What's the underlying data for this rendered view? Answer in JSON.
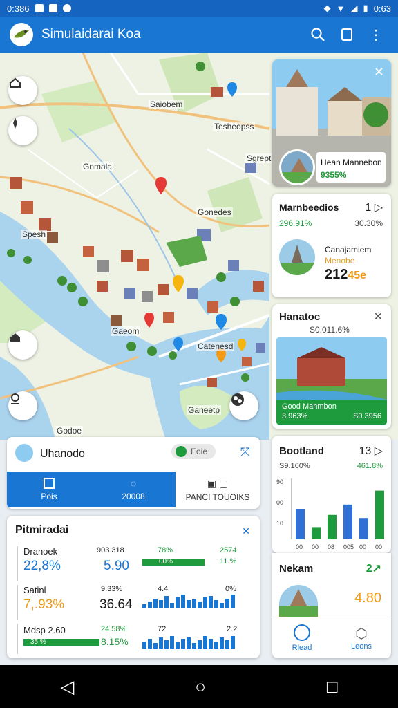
{
  "status_bar": {
    "time": "0:386",
    "right_time": "0:63"
  },
  "app_bar": {
    "title": "Simulaidarai Koa"
  },
  "map": {
    "labels": [
      "Saiobem",
      "Tesheopss",
      "Gnmala",
      "Gonedes",
      "Spesh",
      "Gaeom",
      "Ganeetp",
      "Catenesd",
      "Godoe",
      "Sgrepte"
    ]
  },
  "cards": {
    "photo1": {
      "title": "Hean Mannebon",
      "value": "9355%"
    },
    "stat1": {
      "title": "Marnbeedios",
      "count": "1",
      "left_pct": "296.91%",
      "right_pct": "30.30%",
      "sub_title": "Canajamiem",
      "sub_label": "Menobe",
      "big_value": "212",
      "accent_value": "45e"
    },
    "hanatoc": {
      "title": "Hanatoc",
      "sub": "S0.011.6%",
      "photo_title": "Good Mahmbon",
      "photo_left": "3.963%",
      "photo_right": "S0.3956"
    },
    "board": {
      "title": "Bootland",
      "count": "13",
      "left_pct": "S9.160%",
      "right_pct": "461.8%",
      "y_ticks": [
        "90",
        "00",
        "10"
      ],
      "x_ticks": [
        "00",
        "00",
        "08",
        "005",
        "00",
        "00"
      ]
    },
    "nekam": {
      "title": "Nekam",
      "delta": "2",
      "value": "4.80"
    }
  },
  "chart_data": {
    "type": "bar",
    "categories": [
      "00",
      "00",
      "08",
      "005",
      "00",
      "00"
    ],
    "series": [
      {
        "values": [
          50,
          20,
          40,
          57,
          35,
          80
        ],
        "colors": [
          "#2f6fd6",
          "#1e9b3d",
          "#1e9b3d",
          "#2f6fd6",
          "#2f6fd6",
          "#1e9b3d"
        ]
      }
    ],
    "ylim": [
      0,
      100
    ]
  },
  "bottom_panel": {
    "title": "Uhanodo",
    "pill": "Eoie",
    "tabs": [
      {
        "label": "Pois"
      },
      {
        "label": "20008"
      },
      {
        "label": "PANCI TOUOIKS"
      }
    ]
  },
  "stats": {
    "title": "Pitmiradai",
    "rows": [
      {
        "label": "Dranoek",
        "big": "22,8%",
        "mid_top": "903.318",
        "mid": "5.90",
        "right_top": "78%",
        "right_mid": "2574",
        "bar_pct": "00%",
        "right_sub": "11.%"
      },
      {
        "label": "Satinl",
        "big": "7,.93%",
        "mid_top": "9.33%",
        "mid": "36.64",
        "right_top": "4.4",
        "right_mid": "0%"
      },
      {
        "label": "Mdsp 2.60",
        "big": "35 %",
        "mid_top": "24.58%",
        "mid": "8.15%",
        "right_top": "72",
        "right_mid": "2.2"
      }
    ]
  },
  "bottom_tabs": {
    "left": "Rlead",
    "right": "Leons"
  }
}
